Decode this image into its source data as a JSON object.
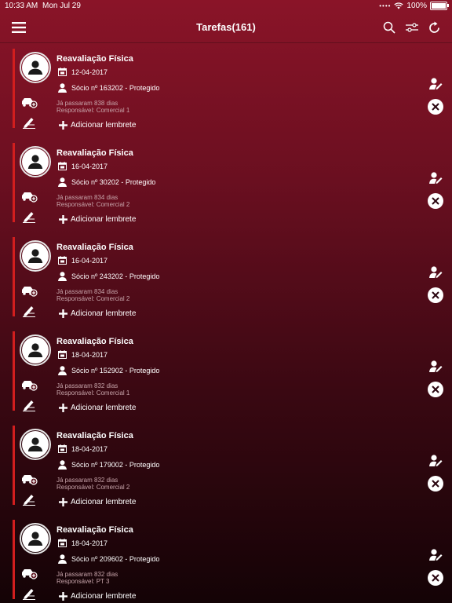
{
  "status": {
    "time": "10:33 AM",
    "date": "Mon Jul 29",
    "battery": "100%",
    "battery_level": 1.0
  },
  "nav": {
    "title": "Tarefas(161)",
    "menu_icon": "hamburger-icon",
    "search_icon": "search-icon",
    "filter_icon": "sliders-icon",
    "refresh_icon": "refresh-icon"
  },
  "colors": {
    "accent": "#d21e1e",
    "bg_top": "#8a1428",
    "bg_bottom": "#140306",
    "muted": "#c7a4aa"
  },
  "tasks": [
    {
      "title": "Reavaliação Física",
      "date": "12-04-2017",
      "socio": "Sócio nº 163202 - Protegido",
      "days": "Já passaram 838 dias",
      "responsavel": "Responsável: Comercial 1",
      "add_label": "Adicionar lembrete"
    },
    {
      "title": "Reavaliação Física",
      "date": "16-04-2017",
      "socio": "Sócio nº 30202 - Protegido",
      "days": "Já passaram 834 dias",
      "responsavel": "Responsável: Comercial 2",
      "add_label": "Adicionar lembrete"
    },
    {
      "title": "Reavaliação Física",
      "date": "16-04-2017",
      "socio": "Sócio nº 243202 - Protegido",
      "days": "Já passaram 834 dias",
      "responsavel": "Responsável: Comercial 2",
      "add_label": "Adicionar lembrete"
    },
    {
      "title": "Reavaliação Física",
      "date": "18-04-2017",
      "socio": "Sócio nº 152902 - Protegido",
      "days": "Já passaram 832 dias",
      "responsavel": "Responsável: Comercial 1",
      "add_label": "Adicionar lembrete"
    },
    {
      "title": "Reavaliação Física",
      "date": "18-04-2017",
      "socio": "Sócio nº 179002 - Protegido",
      "days": "Já passaram 832 dias",
      "responsavel": "Responsável: Comercial 2",
      "add_label": "Adicionar lembrete"
    },
    {
      "title": "Reavaliação Física",
      "date": "18-04-2017",
      "socio": "Sócio nº 209602 - Protegido",
      "days": "Já passaram 832 dias",
      "responsavel": "Responsável: PT 3",
      "add_label": "Adicionar lembrete"
    }
  ]
}
